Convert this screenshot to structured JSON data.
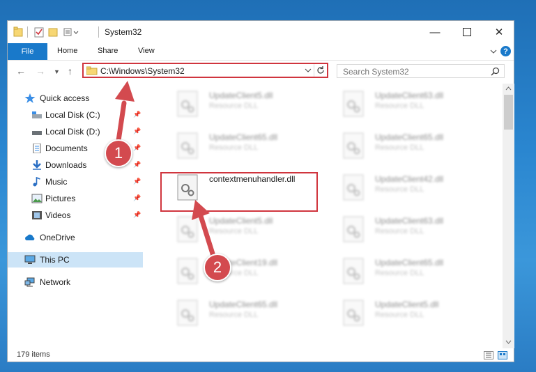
{
  "window": {
    "title": "System32"
  },
  "ribbon": {
    "file_label": "File",
    "tabs": [
      "Home",
      "Share",
      "View"
    ],
    "help": "?"
  },
  "nav": {
    "address": "C:\\Windows\\System32",
    "search_placeholder": "Search System32"
  },
  "sidebar": {
    "items": [
      {
        "label": "Quick access",
        "icon": "star-icon"
      },
      {
        "label": "Local Disk (C:)",
        "icon": "drive-icon",
        "pinned": true
      },
      {
        "label": "Local Disk (D:)",
        "icon": "drive-icon",
        "pinned": true
      },
      {
        "label": "Documents",
        "icon": "document-icon",
        "pinned": true
      },
      {
        "label": "Downloads",
        "icon": "download-icon",
        "pinned": true
      },
      {
        "label": "Music",
        "icon": "music-icon",
        "pinned": true
      },
      {
        "label": "Pictures",
        "icon": "picture-icon",
        "pinned": true
      },
      {
        "label": "Videos",
        "icon": "video-icon",
        "pinned": true
      },
      {
        "label": "OneDrive",
        "icon": "cloud-icon"
      },
      {
        "label": "This PC",
        "icon": "computer-icon",
        "selected": true
      },
      {
        "label": "Network",
        "icon": "network-icon"
      }
    ]
  },
  "files": {
    "left": [
      {
        "name": "UpdateClient5.dll",
        "type": "Resource DLL"
      },
      {
        "name": "UpdateClient65.dll",
        "type": "Resource DLL"
      },
      {
        "name": "contextmenuhandler.dll",
        "type": ""
      },
      {
        "name": "UpdateClient5.dll",
        "type": "Resource DLL"
      },
      {
        "name": "UpdateClient19.dll",
        "type": "Resource DLL"
      },
      {
        "name": "UpdateClient65.dll",
        "type": "Resource DLL"
      }
    ],
    "right": [
      {
        "name": "UpdateClient63.dll",
        "type": "Resource DLL"
      },
      {
        "name": "UpdateClient65.dll",
        "type": "Resource DLL"
      },
      {
        "name": "UpdateClient42.dll",
        "type": "Resource DLL"
      },
      {
        "name": "UpdateClient63.dll",
        "type": "Resource DLL"
      },
      {
        "name": "UpdateClient65.dll",
        "type": "Resource DLL"
      },
      {
        "name": "UpdateClient5.dll",
        "type": "Resource DLL"
      }
    ]
  },
  "status": {
    "count": "179 items"
  },
  "annotations": {
    "step1": "1",
    "step2": "2"
  },
  "colors": {
    "accent": "#1979ca",
    "highlight": "#d0353e",
    "badge": "#d34a4f",
    "selected": "#cce4f7"
  }
}
